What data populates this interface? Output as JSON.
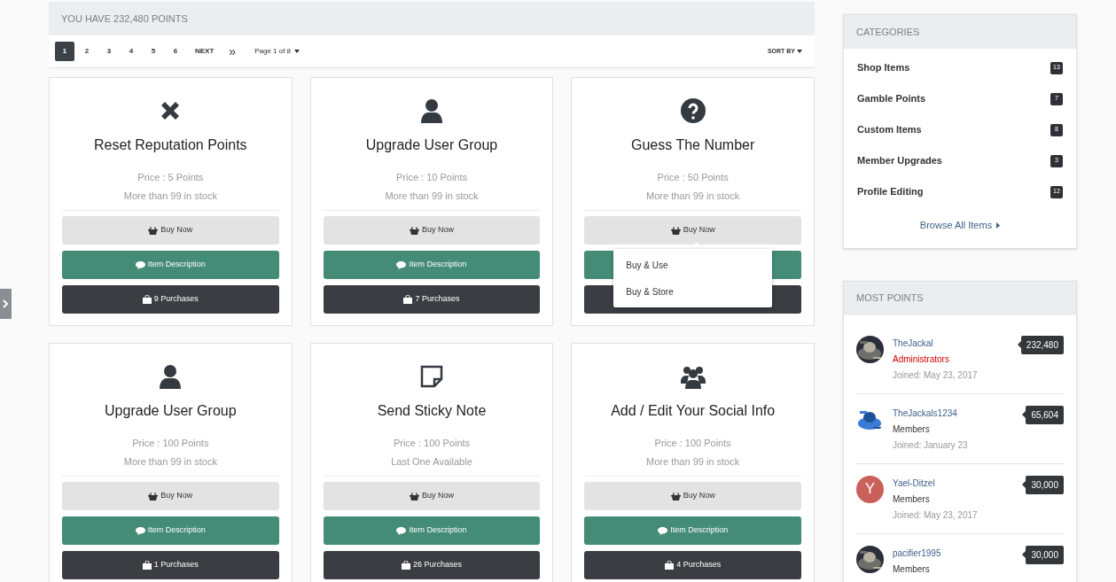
{
  "points_header": "YOU HAVE 232,480 POINTS",
  "pagination": {
    "pages": [
      {
        "label": "1",
        "selected": true
      },
      {
        "label": "2",
        "selected": false
      },
      {
        "label": "3",
        "selected": false
      },
      {
        "label": "4",
        "selected": false
      },
      {
        "label": "5",
        "selected": false
      },
      {
        "label": "6",
        "selected": false
      }
    ],
    "next": "NEXT",
    "last": "»",
    "page_menu": "Page 1 of 8",
    "sort": "SORT BY"
  },
  "items": [
    {
      "kind": "x",
      "title": "Reset Reputation Points",
      "price": "Price : 5 Points",
      "stock": "More than 99 in stock",
      "buy": "Buy Now",
      "description": "Item Description",
      "purchases": "9 Purchases"
    },
    {
      "kind": "user",
      "title": "Upgrade User Group",
      "price": "Price : 10 Points",
      "stock": "More than 99 in stock",
      "buy": "Buy Now",
      "description": "Item Description",
      "purchases": "7 Purchases"
    },
    {
      "kind": "question",
      "title": "Guess The Number",
      "price": "Price : 50 Points",
      "stock": "More than 99 in stock",
      "buy": "Buy Now",
      "menu": [
        "Buy & Use",
        "Buy & Store"
      ]
    },
    {
      "kind": "user",
      "title": "Upgrade User Group",
      "price": "Price : 100 Points",
      "stock": "More than 99 in stock",
      "buy": "Buy Now",
      "description": "Item Description",
      "purchases": "1 Purchases"
    },
    {
      "kind": "note",
      "title": "Send Sticky Note",
      "price": "Price : 100 Points",
      "stock": "Last One Available",
      "buy": "Buy Now",
      "description": "Item Description",
      "purchases": "26 Purchases"
    },
    {
      "kind": "users",
      "title": "Add / Edit Your Social Info",
      "price": "Price : 100 Points",
      "stock": "More than 99 in stock",
      "buy": "Buy Now",
      "description": "Item Description",
      "purchases": "4 Purchases"
    }
  ],
  "categories": {
    "title": "CATEGORIES",
    "items": [
      {
        "label": "Shop Items",
        "count": "13"
      },
      {
        "label": "Gamble Points",
        "count": "7"
      },
      {
        "label": "Custom Items",
        "count": "8"
      },
      {
        "label": "Member Upgrades",
        "count": "3"
      },
      {
        "label": "Profile Editing",
        "count": "12"
      }
    ],
    "browse": "Browse All Items"
  },
  "most_points": {
    "title": "MOST POINTS",
    "members": [
      {
        "kind": "admin",
        "name": "TheJackal",
        "group": "Administrators",
        "joined": "Joined: May 23, 2017",
        "points": "232,480"
      },
      {
        "kind": "member",
        "name": "TheJackals1234",
        "group": "Members",
        "joined": "Joined: January 23",
        "points": "65,604"
      },
      {
        "kind": "member",
        "name": "Yael-Ditzel",
        "group": "Members",
        "joined": "Joined: May 23, 2017",
        "points": "30,000",
        "avatar": {
          "kind": "letter",
          "letter": "Y",
          "color": "#c9605a"
        }
      },
      {
        "kind": "member",
        "name": "pacifier1995",
        "group": "Members",
        "points": "30,000"
      }
    ]
  }
}
